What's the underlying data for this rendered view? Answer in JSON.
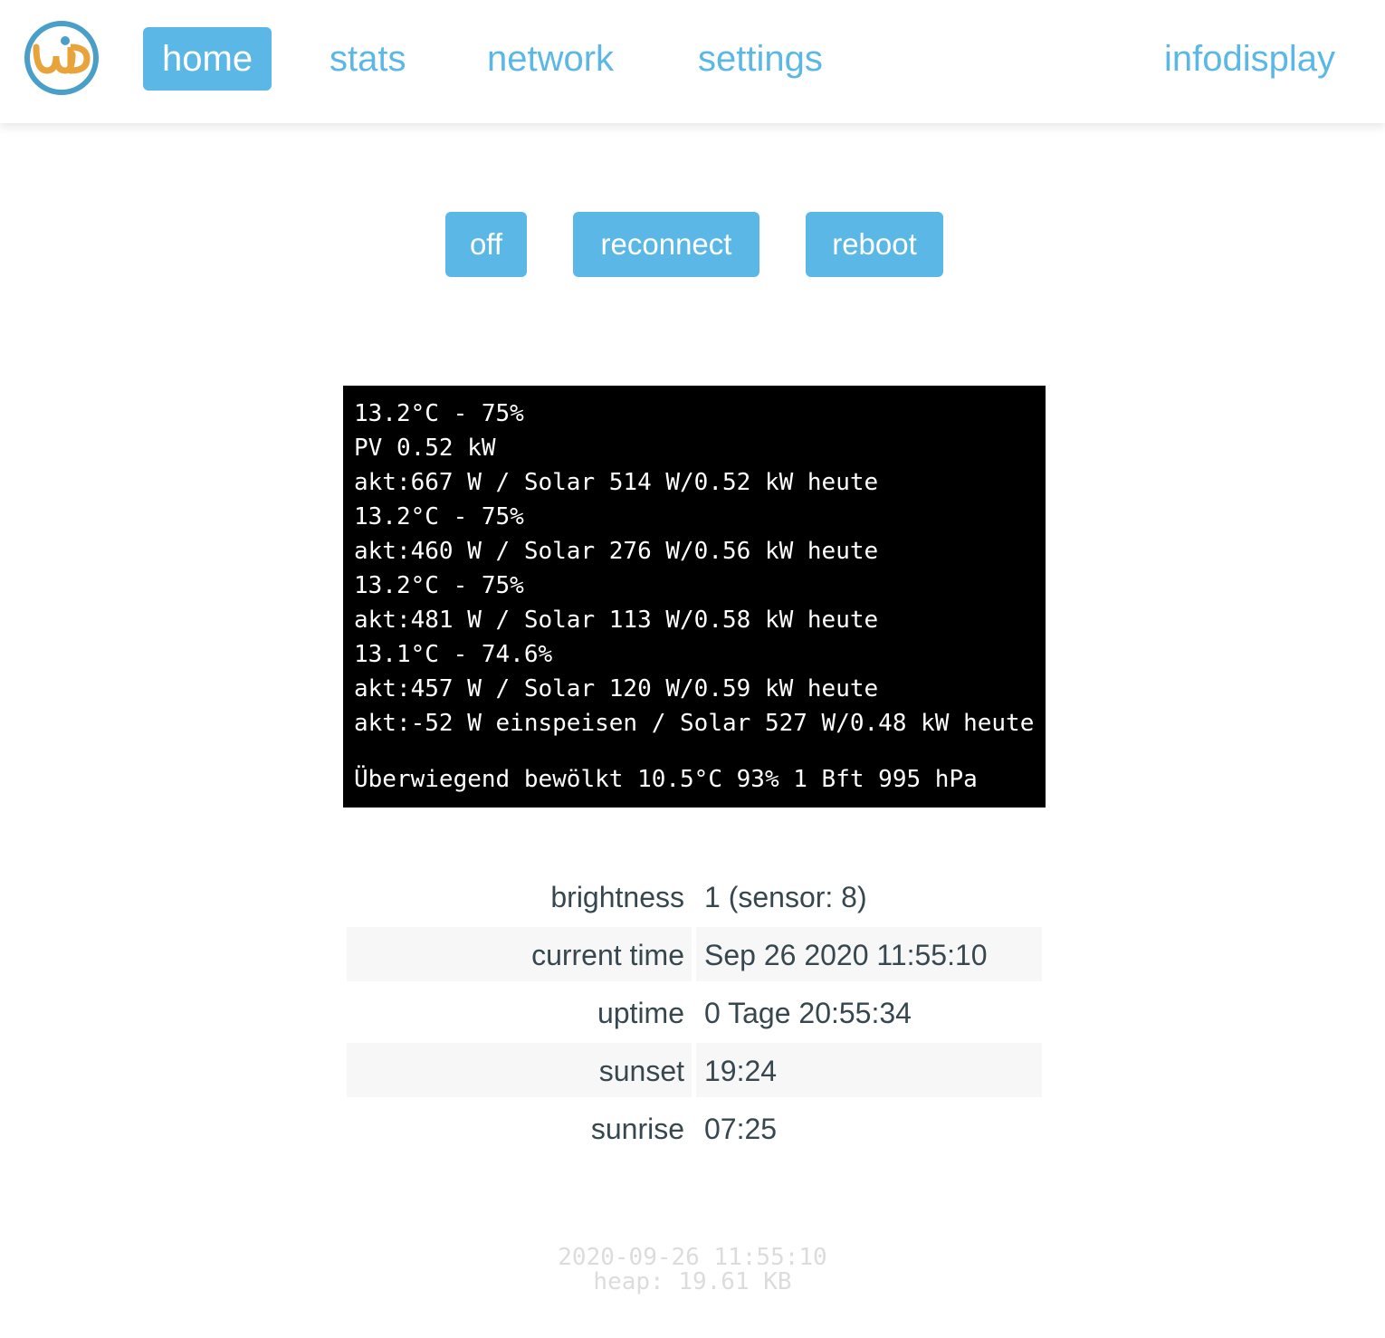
{
  "header": {
    "logo_text": "wD",
    "nav": [
      {
        "label": "home",
        "active": true
      },
      {
        "label": "stats",
        "active": false
      },
      {
        "label": "network",
        "active": false
      },
      {
        "label": "settings",
        "active": false
      }
    ],
    "brand": "infodisplay"
  },
  "actions": {
    "off": "off",
    "reconnect": "reconnect",
    "reboot": "reboot"
  },
  "display": {
    "lines": [
      "13.2°C - 75%",
      "PV 0.52 kW",
      "akt:667 W / Solar 514 W/0.52 kW heute",
      "13.2°C - 75%",
      "akt:460 W / Solar 276 W/0.56 kW heute",
      "13.2°C - 75%",
      "akt:481 W / Solar 113 W/0.58 kW heute",
      "13.1°C - 74.6%",
      "akt:457 W / Solar 120 W/0.59 kW heute",
      "akt:-52 W einspeisen / Solar 527 W/0.48 kW heute"
    ],
    "weather": "Überwiegend bewölkt 10.5°C 93% 1 Bft 995 hPa"
  },
  "info": {
    "brightness": {
      "label": "brightness",
      "value": "1 (sensor: 8)"
    },
    "current_time": {
      "label": "current time",
      "value": "Sep 26 2020 11:55:10"
    },
    "uptime": {
      "label": "uptime",
      "value": "0 Tage 20:55:34"
    },
    "sunset": {
      "label": "sunset",
      "value": "19:24"
    },
    "sunrise": {
      "label": "sunrise",
      "value": "07:25"
    }
  },
  "footer": {
    "timestamp": "2020-09-26 11:55:10",
    "heap": "heap: 19.61 KB"
  },
  "colors": {
    "accent": "#5bb8e6",
    "logo_ring": "#4a9fc9",
    "logo_letters": "#e9a33b",
    "text": "#37474f",
    "stripe": "#f7f7f7",
    "display_bg": "#000000"
  }
}
